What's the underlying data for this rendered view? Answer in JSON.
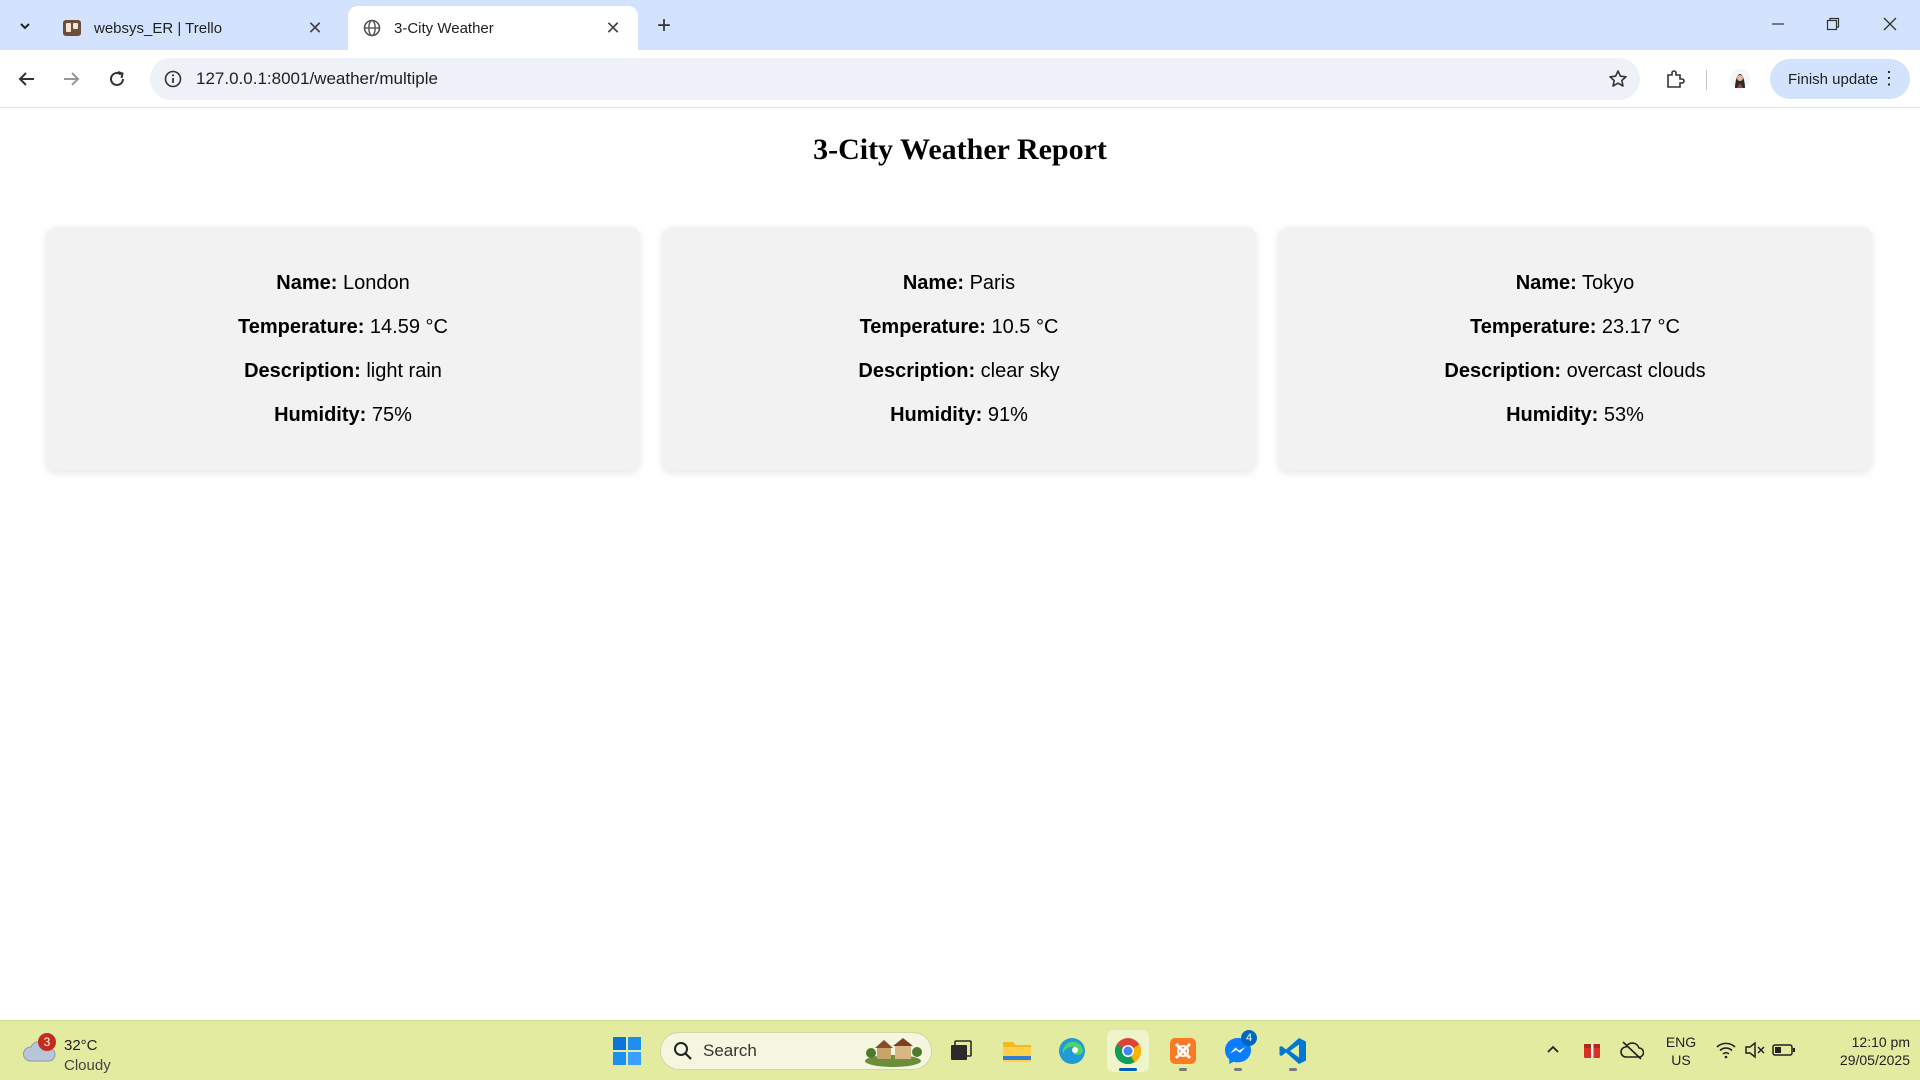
{
  "browser": {
    "tabs": [
      {
        "title": "websys_ER | Trello",
        "active": false
      },
      {
        "title": "3-City Weather",
        "active": true
      }
    ],
    "url": "127.0.0.1:8001/weather/multiple",
    "finish_update_label": "Finish update"
  },
  "page": {
    "title": "3-City Weather Report",
    "labels": {
      "name": "Name:",
      "temperature": "Temperature:",
      "description": "Description:",
      "humidity": "Humidity:"
    },
    "cities": [
      {
        "name": "London",
        "temperature": "14.59 °C",
        "description": "light rain",
        "humidity": "75%"
      },
      {
        "name": "Paris",
        "temperature": "10.5 °C",
        "description": "clear sky",
        "humidity": "91%"
      },
      {
        "name": "Tokyo",
        "temperature": "23.17 °C",
        "description": "overcast clouds",
        "humidity": "53%"
      }
    ]
  },
  "taskbar": {
    "weather": {
      "temp": "32°C",
      "condition": "Cloudy",
      "badge": "3"
    },
    "search_placeholder": "Search",
    "messenger_badge": "4",
    "lang_line1": "ENG",
    "lang_line2": "US",
    "time": "12:10 pm",
    "date": "29/05/2025"
  },
  "colors": {
    "tabstrip": "#d3e3fd",
    "card_bg": "#f2f2f2",
    "taskbar": "#e3eba0"
  }
}
